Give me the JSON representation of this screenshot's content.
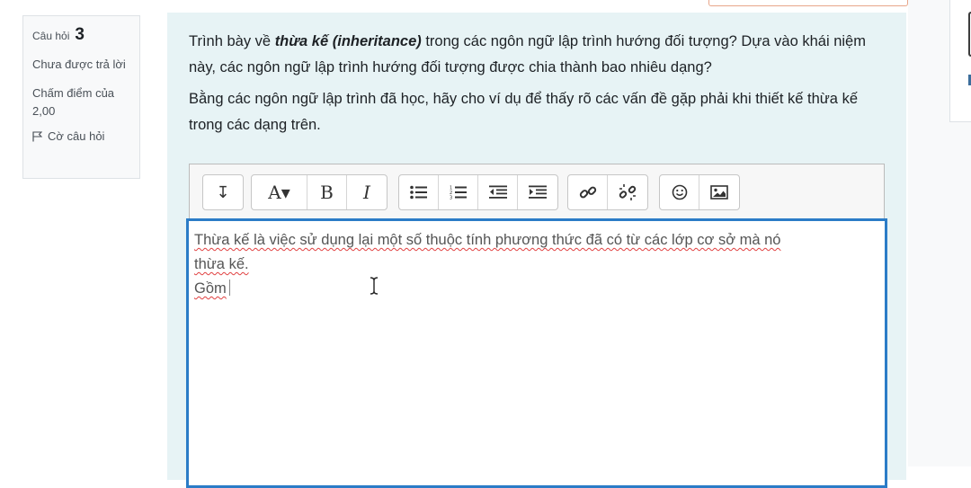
{
  "question_info": {
    "label": "Câu hỏi",
    "number": "3",
    "state": "Chưa được trả lời",
    "grade": "Chấm điểm của 2,00",
    "flag_label": "Cờ câu hỏi",
    "flag_icon": "flag-icon"
  },
  "question": {
    "p1_before": "Trình bày về ",
    "p1_emph": "thừa kế (inheritance)",
    "p1_after": " trong các ngôn ngữ lập trình hướng đối tượng? Dựa vào khái niệm này, các ngôn ngữ lập trình hướng đối tượng được chia thành bao nhiêu dạng?",
    "p2": "Bằng các ngôn ngữ lập trình đã học, hãy cho ví dụ để thấy rõ các vấn đề gặp phải khi thiết kế thừa kế trong các dạng trên."
  },
  "toolbar": {
    "collapse_label": "↧",
    "font_label": "A▾",
    "bold_label": "B",
    "italic_label": "I"
  },
  "editor": {
    "line1": "Thừa kế là việc sử dụng lại một số thuộc tính phương thức đã có từ các lớp cơ sở mà nó",
    "line2": "thừa kế.",
    "line3": "Gồm"
  },
  "colors": {
    "content_bg": "#e7f3f5",
    "editor_border": "#2b7cc7",
    "spell_underline": "#e04040"
  }
}
